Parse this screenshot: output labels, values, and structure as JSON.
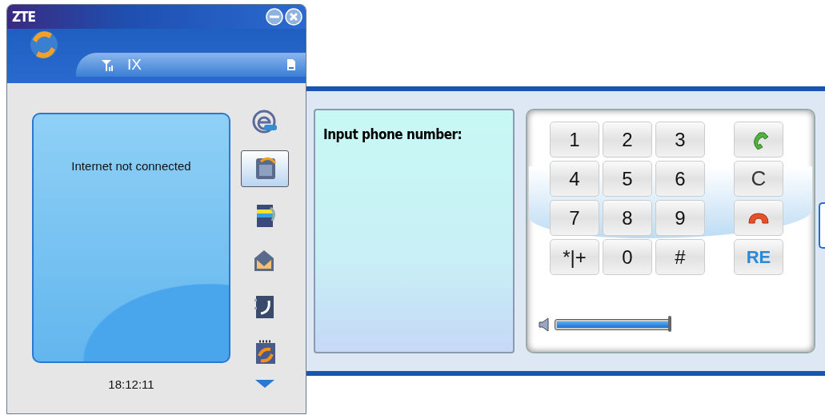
{
  "window": {
    "title": "ZTE"
  },
  "status": {
    "network": "IX"
  },
  "screen": {
    "message": "Internet not connected"
  },
  "clock": "18:12:11",
  "nav": [
    {
      "kind": "browser",
      "selected": false
    },
    {
      "kind": "phone",
      "selected": true
    },
    {
      "kind": "notes",
      "selected": false
    },
    {
      "kind": "mail",
      "selected": false
    },
    {
      "kind": "contacts",
      "selected": false
    },
    {
      "kind": "sync",
      "selected": false
    }
  ],
  "dialer": {
    "prompt": "Input phone number:",
    "keys": [
      "1",
      "2",
      "3",
      "4",
      "5",
      "6",
      "7",
      "8",
      "9",
      "*|+",
      "0",
      "#"
    ],
    "actions": [
      {
        "kind": "call"
      },
      {
        "kind": "clear",
        "label": "C"
      },
      {
        "kind": "end"
      },
      {
        "kind": "redial",
        "label": "RE"
      }
    ],
    "volume": {
      "level": 1
    }
  }
}
